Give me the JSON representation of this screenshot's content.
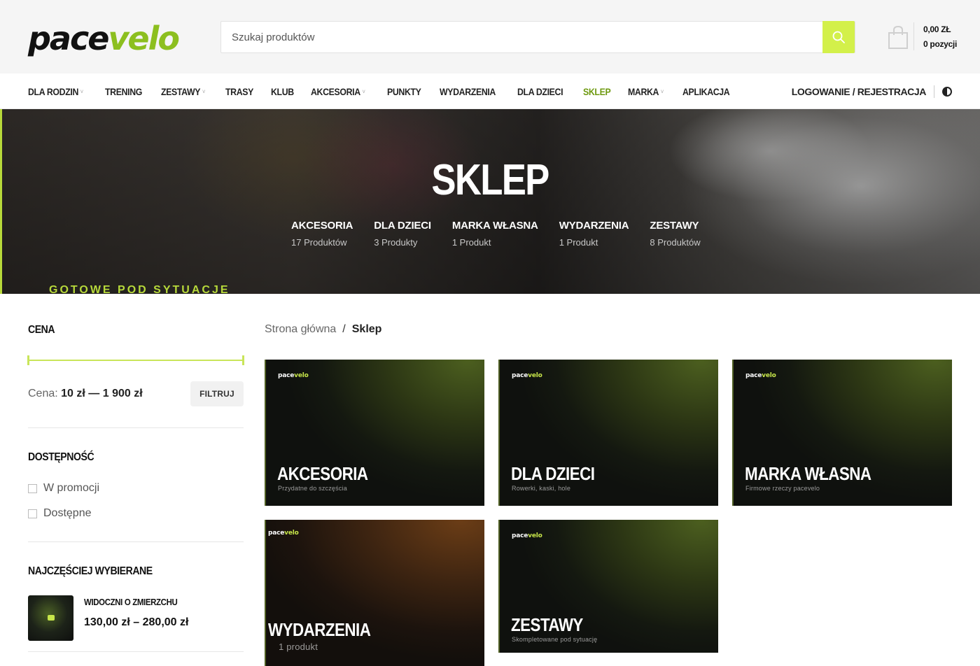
{
  "header": {
    "logo_part1": "pace",
    "logo_part2": "velo",
    "search_placeholder": "Szukaj produktów",
    "cart_total": "0,00 ZŁ",
    "cart_count": "0 pozycji",
    "brand_color": "#8cbf1f",
    "accent_color": "#d3f04a"
  },
  "nav": {
    "items": [
      {
        "label": "DLA RODZIN",
        "dropdown": true
      },
      {
        "label": "TRENING",
        "dropdown": false
      },
      {
        "label": "ZESTAWY",
        "dropdown": true
      },
      {
        "label": "TRASY",
        "dropdown": false
      },
      {
        "label": "KLUB",
        "dropdown": false
      },
      {
        "label": "AKCESORIA",
        "dropdown": true
      },
      {
        "label": "PUNKTY",
        "dropdown": false
      },
      {
        "label": "WYDARZENIA",
        "dropdown": false
      },
      {
        "label": "DLA DZIECI",
        "dropdown": false
      },
      {
        "label": "SKLEP",
        "dropdown": false,
        "active": true
      },
      {
        "label": "MARKA",
        "dropdown": true
      },
      {
        "label": "APLIKACJA",
        "dropdown": false
      }
    ],
    "login": "LOGOWANIE / REJESTRACJA"
  },
  "hero": {
    "title": "SKLEP",
    "strip_text": "GOTOWE POD SYTUACJE",
    "categories": [
      {
        "name": "AKCESORIA",
        "count": "17 Produktów"
      },
      {
        "name": "DLA DZIECI",
        "count": "3 Produkty"
      },
      {
        "name": "MARKA WŁASNA",
        "count": "1 Produkt"
      },
      {
        "name": "WYDARZENIA",
        "count": "1 Produkt"
      },
      {
        "name": "ZESTAWY",
        "count": "8 Produktów"
      }
    ]
  },
  "sidebar": {
    "price_title": "CENA",
    "price_prefix": "Cena:",
    "price_range": "10 zł — 1 900 zł",
    "filter_button": "FILTRUJ",
    "availability_title": "DOSTĘPNOŚĆ",
    "availability_options": [
      "W promocji",
      "Dostępne"
    ],
    "popular_title": "NAJCZĘŚCIEJ WYBIERANE",
    "popular_product": {
      "name": "WIDOCZNI O ZMIERZCHU",
      "price": "130,00 zł – 280,00 zł"
    }
  },
  "breadcrumb": {
    "home": "Strona główna",
    "separator": "/",
    "current": "Sklep"
  },
  "cards": [
    {
      "logo1": "pace",
      "logo2": "velo",
      "title": "AKCESORIA",
      "subtitle": "Przydatne do szczęścia",
      "tone": "green"
    },
    {
      "logo1": "pace",
      "logo2": "velo",
      "title": "DLA DZIECI",
      "subtitle": "Rowerki, kaski, hole",
      "tone": "green"
    },
    {
      "logo1": "pace",
      "logo2": "velo",
      "title": "MARKA WŁASNA",
      "subtitle": "Firmowe rzeczy pacevelo",
      "tone": "green"
    },
    {
      "logo1": "pace",
      "logo2": "velo",
      "title": "WYDARZENIA",
      "subtitle": "1 produkt",
      "tone": "brown"
    },
    {
      "logo1": "pace",
      "logo2": "velo",
      "title": "ZESTAWY",
      "subtitle": "Skompletowane pod sytuację",
      "tone": "green"
    }
  ]
}
